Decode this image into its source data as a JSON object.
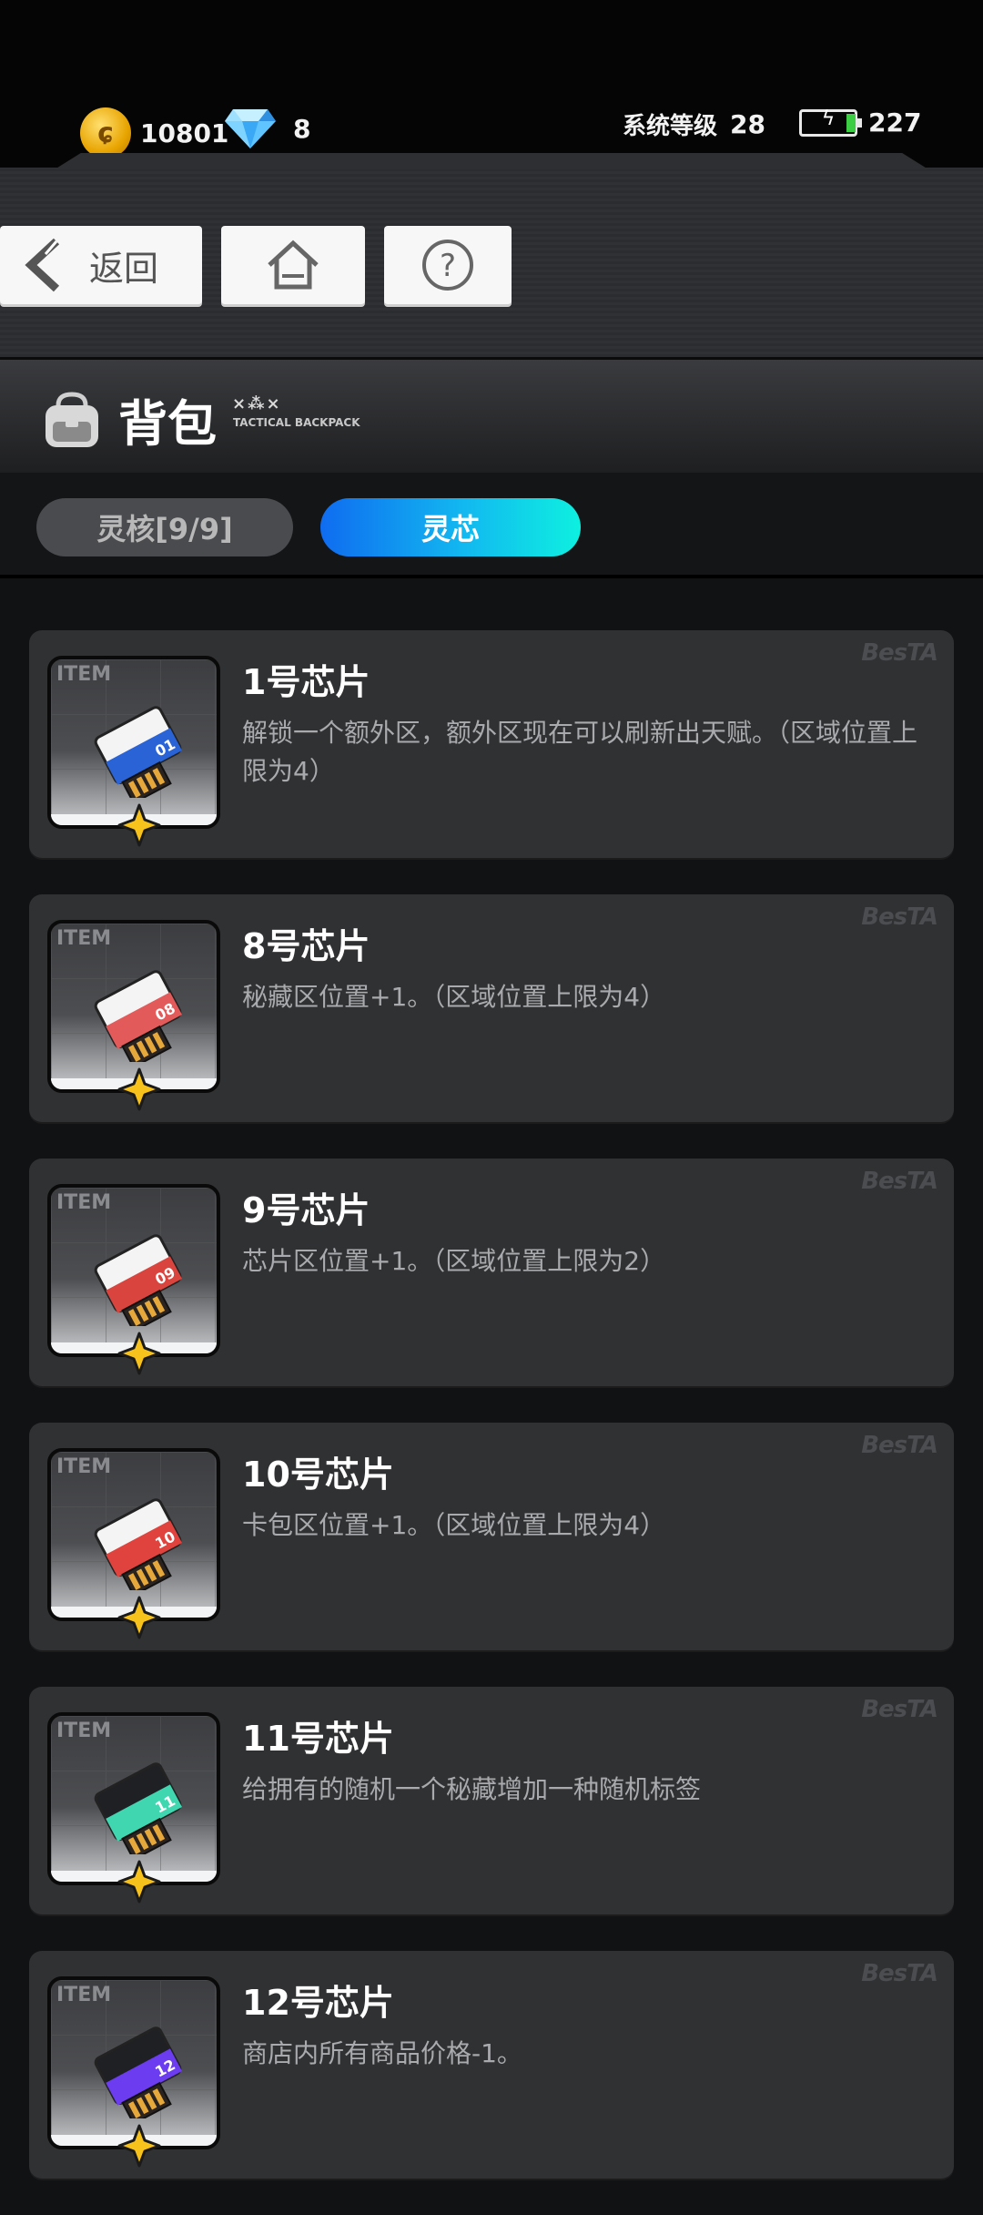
{
  "status": {
    "coins": "10801",
    "gems": "8",
    "level_label": "系统等级",
    "level": "28",
    "energy": "227"
  },
  "nav": {
    "back_label": "返回"
  },
  "header": {
    "title": "背包",
    "marks": "×⁂×",
    "subtitle": "TACTICAL BACKPACK"
  },
  "tabs": [
    {
      "label": "灵核[9/9]",
      "selected": false
    },
    {
      "label": "灵芯",
      "selected": true
    }
  ],
  "items": [
    {
      "icon_label": "ITEM",
      "chip_number": "01",
      "chip_color": "#2a63d6",
      "name": "1号芯片",
      "desc": "解锁一个额外区，额外区现在可以刷新出天赋。（区域位置上限为4）",
      "watermark": "BesTA"
    },
    {
      "icon_label": "ITEM",
      "chip_number": "08",
      "chip_color": "#e35a5a",
      "name": "8号芯片",
      "desc": "秘藏区位置+1。（区域位置上限为4）",
      "watermark": "BesTA"
    },
    {
      "icon_label": "ITEM",
      "chip_number": "09",
      "chip_color": "#d9453e",
      "name": "9号芯片",
      "desc": "芯片区位置+1。（区域位置上限为2）",
      "watermark": "BesTA"
    },
    {
      "icon_label": "ITEM",
      "chip_number": "10",
      "chip_color": "#e0433d",
      "name": "10号芯片",
      "desc": "卡包区位置+1。（区域位置上限为4）",
      "watermark": "BesTA"
    },
    {
      "icon_label": "ITEM",
      "chip_number": "11",
      "chip_color": "#3fd6b0",
      "name": "11号芯片",
      "desc": "给拥有的随机一个秘藏增加一种随机标签",
      "watermark": "BesTA"
    },
    {
      "icon_label": "ITEM",
      "chip_number": "12",
      "chip_color": "#6c3cf0",
      "name": "12号芯片",
      "desc": "商店内所有商品价格-1。",
      "watermark": "BesTA"
    }
  ],
  "colors": {
    "tab_active_start": "#0f6cf0",
    "tab_active_end": "#0ef0e0",
    "card_bg": "#303133",
    "star": "#f7c21b"
  }
}
